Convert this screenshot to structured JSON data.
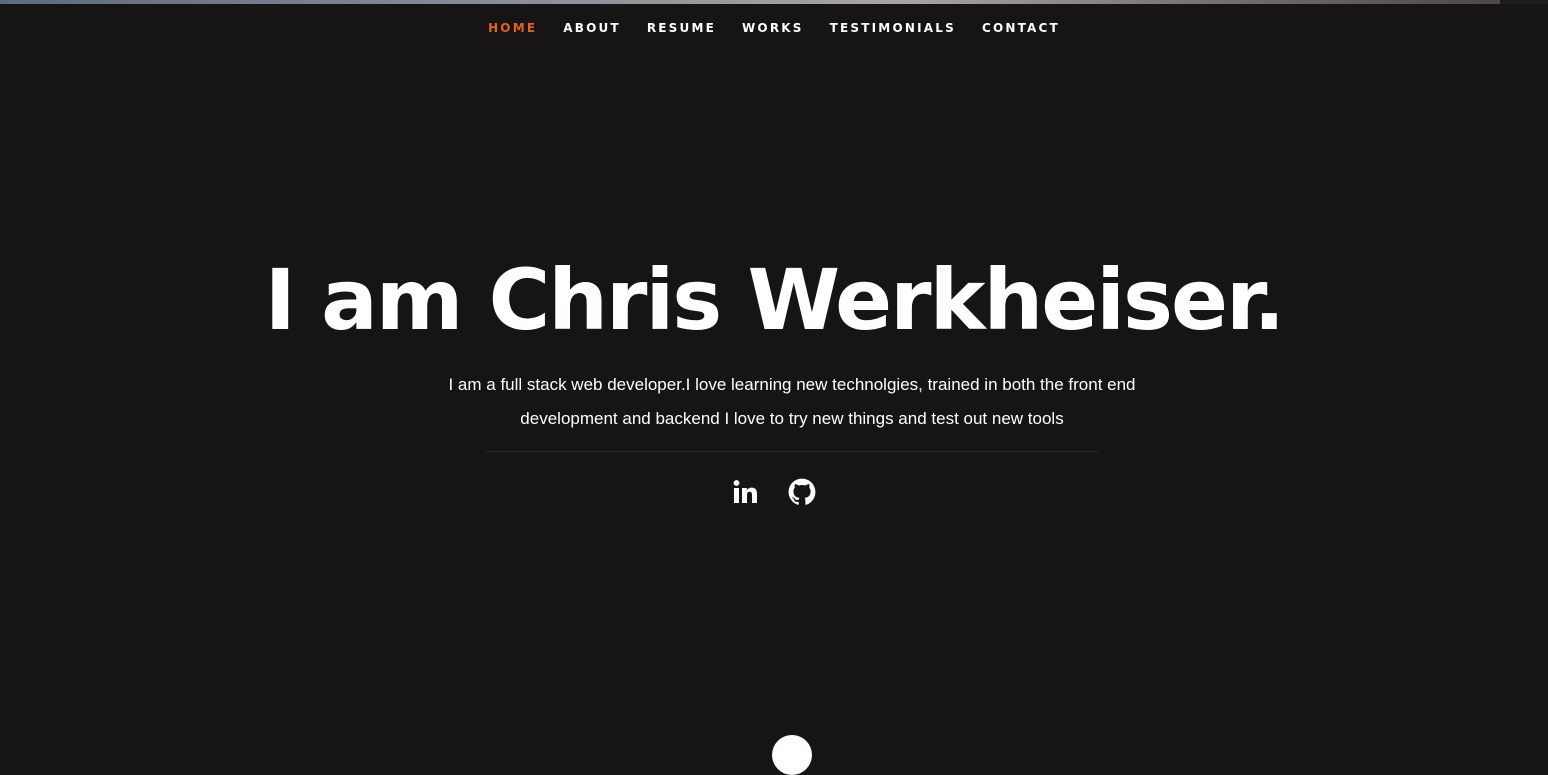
{
  "nav": {
    "items": [
      {
        "label": "HOME",
        "active": true
      },
      {
        "label": "ABOUT",
        "active": false
      },
      {
        "label": "RESUME",
        "active": false
      },
      {
        "label": "WORKS",
        "active": false
      },
      {
        "label": "TESTIMONIALS",
        "active": false
      },
      {
        "label": "CONTACT",
        "active": false
      }
    ]
  },
  "hero": {
    "title": "I am Chris Werkheiser.",
    "description": "I am a full stack web developer.I love learning new technolgies, trained in both the front end development and backend I love to try new things and test out new tools"
  },
  "social": {
    "icons": [
      "linkedin-icon",
      "github-icon"
    ]
  },
  "colors": {
    "background": "#161415",
    "accent": "#e2631d",
    "text": "#ffffff"
  },
  "scroll": {
    "icon": "scroll-down-icon"
  }
}
